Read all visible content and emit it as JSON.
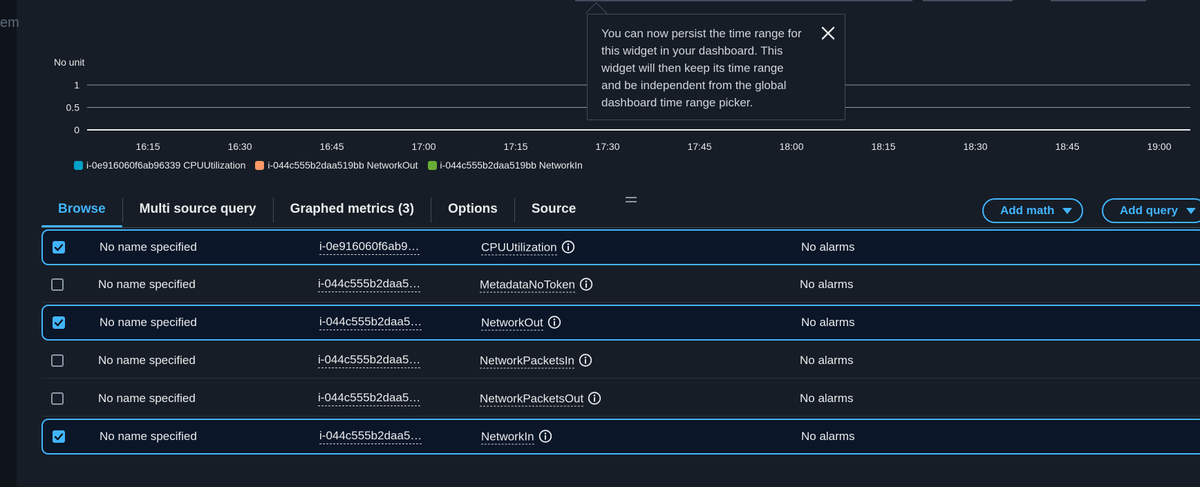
{
  "sidebar": {
    "partial_text": "em"
  },
  "chart_data": {
    "type": "line",
    "ylabel": "No unit",
    "yticks": [
      "1",
      "0.5",
      "0"
    ],
    "ylim": [
      0,
      1
    ],
    "x": [
      "16:15",
      "16:30",
      "16:45",
      "17:00",
      "17:15",
      "17:30",
      "17:45",
      "18:00",
      "18:15",
      "18:30",
      "18:45",
      "19:00"
    ],
    "series": [
      {
        "name": "i-0e916060f6ab96339 CPUUtilization",
        "color": "#00a1c9",
        "values": []
      },
      {
        "name": "i-044c555b2daa519bb NetworkOut",
        "color": "#ff9966",
        "values": []
      },
      {
        "name": "i-044c555b2daa519bb NetworkIn",
        "color": "#69ae34",
        "values": []
      }
    ],
    "grid": true,
    "legend": "bottom-left"
  },
  "popover": {
    "text": "You can now persist the time range for this widget in your dashboard. This widget will then keep its time range and be independent from the global dashboard time range picker."
  },
  "tabs": [
    {
      "label": "Browse",
      "active": true
    },
    {
      "label": "Multi source query",
      "active": false
    },
    {
      "label": "Graphed metrics (3)",
      "active": false
    },
    {
      "label": "Options",
      "active": false
    },
    {
      "label": "Source",
      "active": false
    }
  ],
  "buttons": {
    "add_math": "Add math",
    "add_query": "Add query"
  },
  "rows": [
    {
      "checked": true,
      "name": "No name specified",
      "instance": "i-0e916060f6ab9…",
      "metric": "CPUUtilization",
      "alarms": "No alarms"
    },
    {
      "checked": false,
      "name": "No name specified",
      "instance": "i-044c555b2daa5…",
      "metric": "MetadataNoToken",
      "alarms": "No alarms"
    },
    {
      "checked": true,
      "name": "No name specified",
      "instance": "i-044c555b2daa5…",
      "metric": "NetworkOut",
      "alarms": "No alarms"
    },
    {
      "checked": false,
      "name": "No name specified",
      "instance": "i-044c555b2daa5…",
      "metric": "NetworkPacketsIn",
      "alarms": "No alarms"
    },
    {
      "checked": false,
      "name": "No name specified",
      "instance": "i-044c555b2daa5…",
      "metric": "NetworkPacketsOut",
      "alarms": "No alarms"
    },
    {
      "checked": true,
      "name": "No name specified",
      "instance": "i-044c555b2daa5…",
      "metric": "NetworkIn",
      "alarms": "No alarms"
    }
  ]
}
